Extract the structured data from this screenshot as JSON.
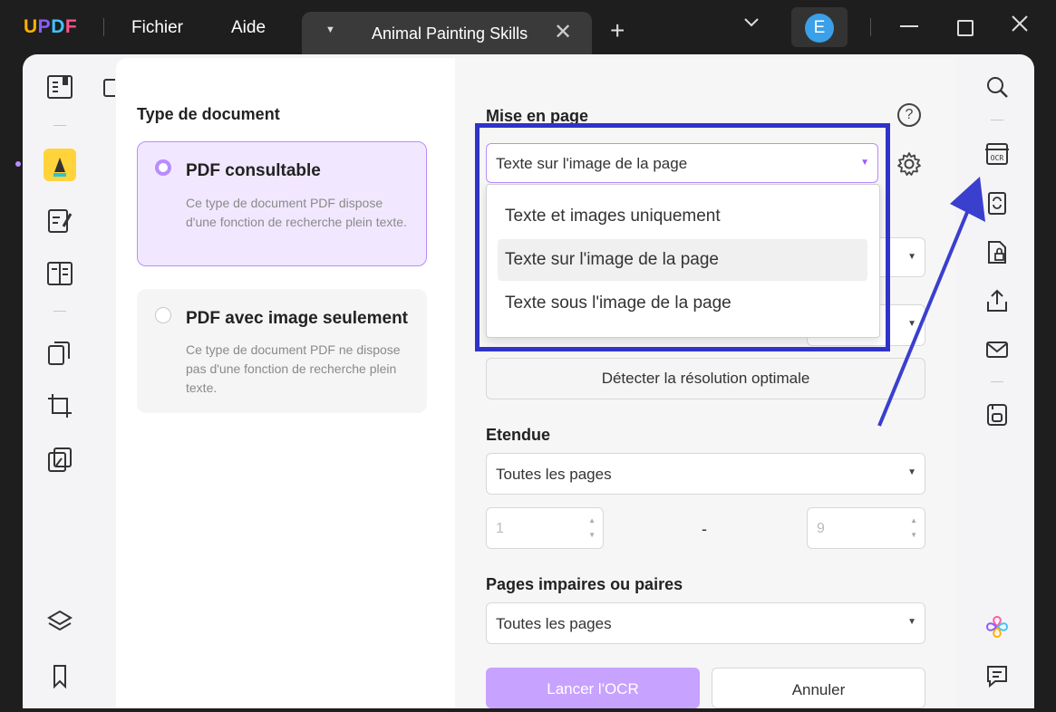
{
  "titlebar": {
    "logo": {
      "u": "U",
      "p": "P",
      "d": "D",
      "f": "F"
    },
    "menu": [
      "Fichier",
      "Aide"
    ],
    "tab_title": "Animal Painting Skills",
    "avatar_letter": "E"
  },
  "dialog": {
    "doc_type_heading": "Type de document",
    "options": [
      {
        "title": "PDF consultable",
        "desc": "Ce type de document PDF dispose d'une fonction de recherche plein texte.",
        "selected": true
      },
      {
        "title": "PDF avec image seulement",
        "desc": "Ce type de document PDF ne dispose pas d'une fonction de recherche plein texte.",
        "selected": false
      }
    ],
    "layout_heading": "Mise en page",
    "layout_selected": "Texte sur l'image de la page",
    "layout_options": [
      "Texte et images uniquement",
      "Texte sur l'image de la page",
      "Texte sous l'image de la page"
    ],
    "detect_button": "Détecter la résolution optimale",
    "range_heading": "Etendue",
    "range_selected": "Toutes les pages",
    "page_from": "1",
    "page_to": "9",
    "range_dash": "-",
    "odd_even_heading": "Pages impaires ou paires",
    "odd_even_selected": "Toutes les pages",
    "run_button": "Lancer l'OCR",
    "cancel_button": "Annuler",
    "help_glyph": "?"
  },
  "colors": {
    "accent_purple": "#b98cff",
    "selected_card_bg": "#f1e8ff",
    "highlight_border": "#2f33c8",
    "arrow": "#3a3fce"
  }
}
